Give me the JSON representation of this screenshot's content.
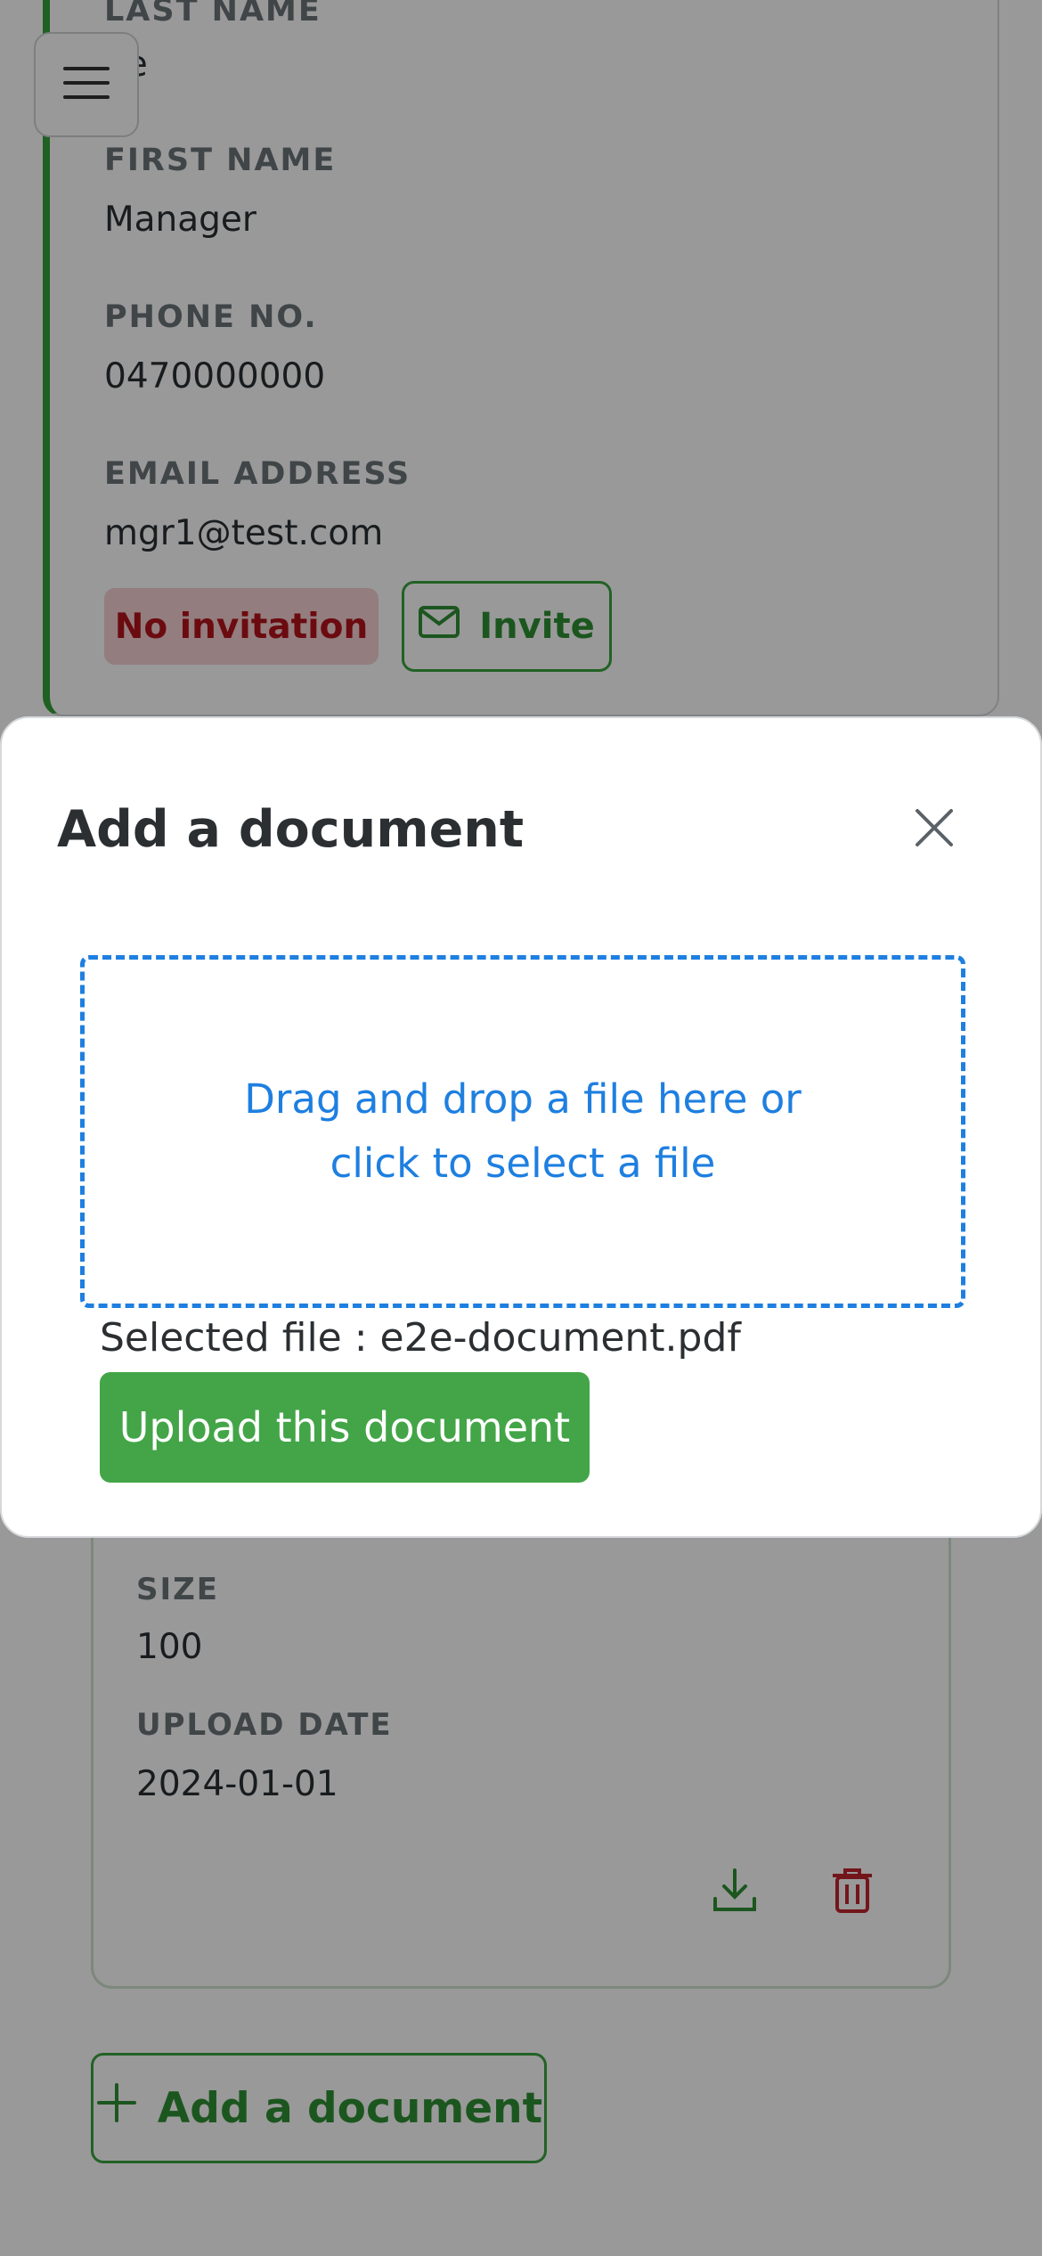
{
  "contact": {
    "last_name_label": "LAST NAME",
    "last_name_value": "ne",
    "first_name_label": "FIRST NAME",
    "first_name_value": "Manager",
    "phone_label": "PHONE NO.",
    "phone_value": "0470000000",
    "email_label": "EMAIL ADDRESS",
    "email_value": "mgr1@test.com",
    "invitation_status": "No invitation",
    "invite_label": "Invite"
  },
  "document": {
    "size_label": "SIZE",
    "size_value": "100",
    "upload_date_label": "UPLOAD DATE",
    "upload_date_value": "2024-01-01"
  },
  "add_document_label": "Add a document",
  "modal": {
    "title": "Add a document",
    "dropzone_text": "Drag and drop a file here or click to select a file",
    "selected_file": "Selected file : e2e-document.pdf",
    "upload_label": "Upload this document"
  },
  "colors": {
    "accent_green": "#43a547",
    "accent_blue": "#1e7fe0",
    "danger_red": "#b3131c"
  },
  "icons": [
    "menu-icon",
    "mail-icon",
    "close-icon",
    "download-icon",
    "trash-icon",
    "plus-icon"
  ]
}
